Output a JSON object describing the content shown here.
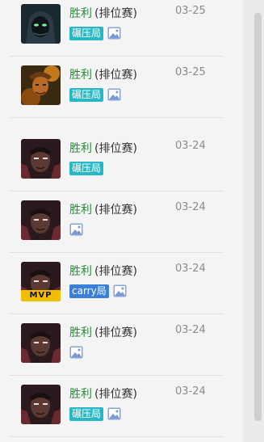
{
  "matches": [
    {
      "result": "胜利",
      "mode": "(排位赛)",
      "date": "03-25",
      "tag": "碾压局",
      "tag_color": "#28b8c4",
      "hero": "hooded-green",
      "mvp": false,
      "has_image_icon": true
    },
    {
      "result": "胜利",
      "mode": "(排位赛)",
      "date": "03-25",
      "tag": "碾压局",
      "tag_color": "#28b8c4",
      "hero": "fire-brawler",
      "mvp": false,
      "has_image_icon": true
    },
    {
      "result": "胜利",
      "mode": "(排位赛)",
      "date": "03-24",
      "tag": "碾压局",
      "tag_color": "#28b8c4",
      "hero": "dark-fighter",
      "mvp": false,
      "has_image_icon": false
    },
    {
      "result": "胜利",
      "mode": "(排位赛)",
      "date": "03-24",
      "tag": "",
      "hero": "dark-fighter",
      "mvp": false,
      "has_image_icon": true
    },
    {
      "result": "胜利",
      "mode": "(排位赛)",
      "date": "03-24",
      "tag": "carry局",
      "tag_color": "#3a7fd8",
      "hero": "dark-fighter",
      "mvp": true,
      "mvp_label": "MVP",
      "has_image_icon": true
    },
    {
      "result": "胜利",
      "mode": "(排位赛)",
      "date": "03-24",
      "tag": "",
      "hero": "dark-fighter",
      "mvp": false,
      "has_image_icon": true
    },
    {
      "result": "胜利",
      "mode": "(排位赛)",
      "date": "03-24",
      "tag": "碾压局",
      "tag_color": "#28b8c4",
      "hero": "dark-fighter",
      "mvp": false,
      "has_image_icon": true
    }
  ],
  "colors": {
    "win": "#2c8a3f",
    "date": "#8a8a8a",
    "teal_tag": "#28b8c4",
    "blue_tag": "#3a7fd8",
    "mvp": "#f0c000"
  }
}
